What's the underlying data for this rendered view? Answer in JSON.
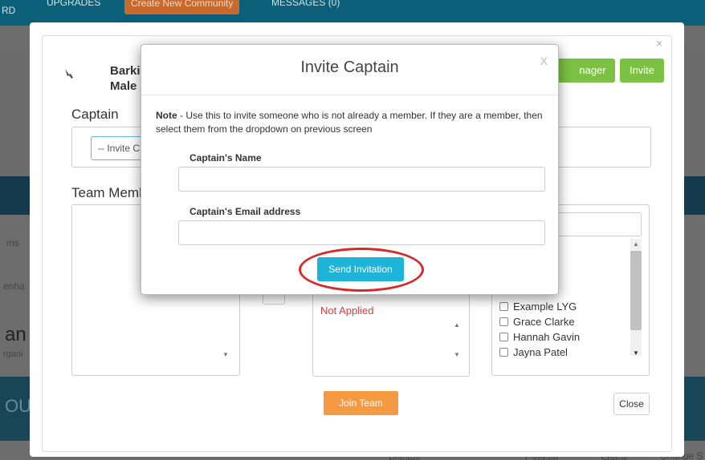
{
  "background": {
    "nav": {
      "item_rd": "RD",
      "item_upgrades": "UPGRADES",
      "item_create": "Create New Community",
      "item_messages": "MESSAGES (0)"
    },
    "fragments": {
      "ms": "ms",
      "enha": "enha",
      "an": "an",
      "rgani": "rgani",
      "ou": "OU",
      "players": "Players",
      "captain": "Captain",
      "status": "Status",
      "change": "Change S"
    }
  },
  "outer_modal": {
    "close_glyph": "×",
    "team_name_line1": "Barki",
    "team_name_line2": "Male",
    "manager_button": "nager",
    "invite_button": "Invite",
    "captain_heading": "Captain",
    "captain_select_value": "-- Invite C",
    "team_members_heading": "Team Memb",
    "not_applied_label": "Not Applied",
    "members": [
      "Example LYG",
      "Grace Clarke",
      "Hannah Gavin",
      "Jayna Patel"
    ],
    "join_team_button": "Join Team",
    "close_button": "Close"
  },
  "invite_modal": {
    "title": "Invite Captain",
    "close_glyph": "X",
    "note_bold": "Note",
    "note_text": " - Use this to invite someone who is not already a member. If they are a member, then select them from the dropdown on previous screen",
    "name_label": "Captain's Name",
    "name_value": "",
    "email_label": "Captain's Email address",
    "email_value": "",
    "send_button": "Send Invitation"
  },
  "colors": {
    "send_button": "#1eb4d7",
    "green_button": "#7bc143",
    "join_button": "#f39a43",
    "highlight_ellipse": "#d42a2a",
    "not_applied": "#e53935"
  }
}
